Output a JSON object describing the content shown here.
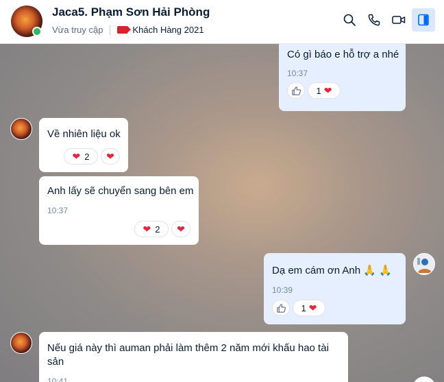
{
  "header": {
    "contact_name": "Jaca5. Phạm Sơn Hải Phòng",
    "status": "Vừa truy cập",
    "tag_label": "Khách Hàng 2021",
    "tag_color": "#d8232a",
    "icons": [
      "search-icon",
      "phone-icon",
      "video-call-icon",
      "sidebar-toggle-icon"
    ]
  },
  "messages": [
    {
      "direction": "out",
      "text": "Có gì báo e hỗ trợ a nhé",
      "time": "10:37",
      "reaction_count": "1"
    },
    {
      "direction": "in",
      "text": "Về nhiên liệu ok",
      "reaction_count": "2"
    },
    {
      "direction": "in",
      "text": "Anh lấy sẽ chuyển sang bên em",
      "time": "10:37",
      "reaction_count": "2"
    },
    {
      "direction": "out",
      "text": "Dạ em cám ơn Anh 🙏 🙏",
      "time": "10:39",
      "reaction_count": "1"
    },
    {
      "direction": "in",
      "text_line1": "Nếu giá này thì auman phải làm thêm 2 năm mới khấu hao tài",
      "text_line2": "sản",
      "time": "10:41"
    }
  ],
  "colors": {
    "accent": "#0068ff",
    "online": "#2dba5b",
    "heart": "#e8243c"
  }
}
